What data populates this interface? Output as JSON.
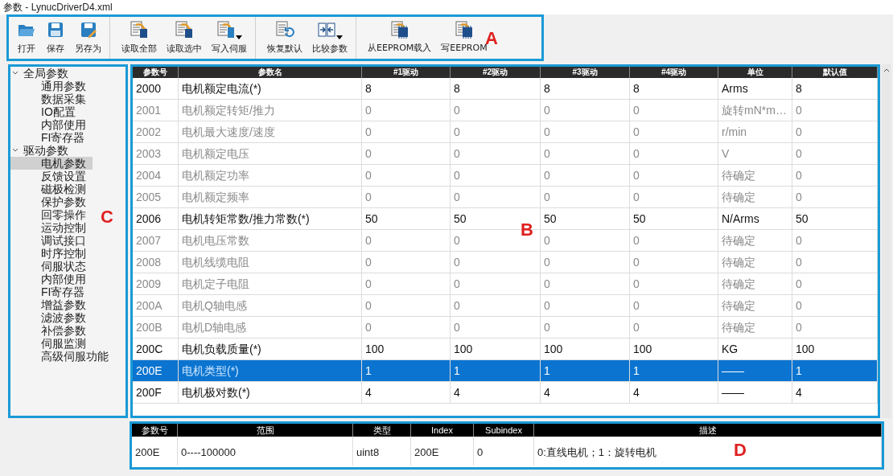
{
  "window": {
    "title": "参数 - LynucDriverD4.xml"
  },
  "toolbar": {
    "annotation": "A",
    "groups": [
      {
        "buttons": [
          {
            "label": "打开",
            "has_menu": false
          },
          {
            "label": "保存",
            "has_menu": false
          },
          {
            "label": "另存为",
            "has_menu": false
          }
        ]
      },
      {
        "buttons": [
          {
            "label": "读取全部",
            "has_menu": false
          },
          {
            "label": "读取选中",
            "has_menu": false
          },
          {
            "label": "写入伺服",
            "has_menu": true
          }
        ]
      },
      {
        "buttons": [
          {
            "label": "恢复默认",
            "has_menu": false
          },
          {
            "label": "比较参数",
            "has_menu": true
          }
        ]
      },
      {
        "buttons": [
          {
            "label": "从EEPROM载入",
            "has_menu": false
          },
          {
            "label": "写EEPROM",
            "has_menu": false
          }
        ]
      }
    ]
  },
  "tree": {
    "annotation": "C",
    "items": [
      {
        "label": "全局参数",
        "expanded": true,
        "selected": false,
        "children": [
          {
            "label": "通用参数",
            "selected": false
          },
          {
            "label": "数据采集",
            "selected": false
          },
          {
            "label": "IO配置",
            "selected": false
          },
          {
            "label": "内部使用",
            "selected": false
          },
          {
            "label": "FI寄存器",
            "selected": false
          }
        ]
      },
      {
        "label": "驱动参数",
        "expanded": true,
        "selected": false,
        "children": [
          {
            "label": "电机参数",
            "selected": true
          },
          {
            "label": "反馈设置",
            "selected": false
          },
          {
            "label": "磁极检测",
            "selected": false
          },
          {
            "label": "保护参数",
            "selected": false
          },
          {
            "label": "回零操作",
            "selected": false
          },
          {
            "label": "运动控制",
            "selected": false
          },
          {
            "label": "调试接口",
            "selected": false
          },
          {
            "label": "时序控制",
            "selected": false
          },
          {
            "label": "伺服状态",
            "selected": false
          },
          {
            "label": "内部使用",
            "selected": false
          },
          {
            "label": "FI寄存器",
            "selected": false
          },
          {
            "label": "增益参数",
            "selected": false
          },
          {
            "label": "滤波参数",
            "selected": false
          },
          {
            "label": "补偿参数",
            "selected": false
          },
          {
            "label": "伺服监测",
            "selected": false
          },
          {
            "label": "高级伺服功能",
            "selected": false
          }
        ]
      }
    ]
  },
  "table": {
    "annotation": "B",
    "columns": [
      "参数号",
      "参数名",
      "#1驱动",
      "#2驱动",
      "#3驱动",
      "#4驱动",
      "单位",
      "默认值"
    ],
    "rows": [
      {
        "cells": [
          "2000",
          "电机额定电流(*)",
          "8",
          "8",
          "8",
          "8",
          "Arms",
          "8"
        ],
        "editable": true,
        "selected": false
      },
      {
        "cells": [
          "2001",
          "电机额定转矩/推力",
          "0",
          "0",
          "0",
          "0",
          "旋转mN*m…",
          "0"
        ],
        "editable": false,
        "selected": false
      },
      {
        "cells": [
          "2002",
          "电机最大速度/速度",
          "0",
          "0",
          "0",
          "0",
          "r/min",
          "0"
        ],
        "editable": false,
        "selected": false
      },
      {
        "cells": [
          "2003",
          "电机额定电压",
          "0",
          "0",
          "0",
          "0",
          "V",
          "0"
        ],
        "editable": false,
        "selected": false
      },
      {
        "cells": [
          "2004",
          "电机额定功率",
          "0",
          "0",
          "0",
          "0",
          "待确定",
          "0"
        ],
        "editable": false,
        "selected": false
      },
      {
        "cells": [
          "2005",
          "电机额定频率",
          "0",
          "0",
          "0",
          "0",
          "待确定",
          "0"
        ],
        "editable": false,
        "selected": false
      },
      {
        "cells": [
          "2006",
          "电机转矩常数/推力常数(*)",
          "50",
          "50",
          "50",
          "50",
          "N/Arms",
          "50"
        ],
        "editable": true,
        "selected": false
      },
      {
        "cells": [
          "2007",
          "电机电压常数",
          "0",
          "0",
          "0",
          "0",
          "待确定",
          "0"
        ],
        "editable": false,
        "selected": false
      },
      {
        "cells": [
          "2008",
          "电机线缆电阻",
          "0",
          "0",
          "0",
          "0",
          "待确定",
          "0"
        ],
        "editable": false,
        "selected": false
      },
      {
        "cells": [
          "2009",
          "电机定子电阻",
          "0",
          "0",
          "0",
          "0",
          "待确定",
          "0"
        ],
        "editable": false,
        "selected": false
      },
      {
        "cells": [
          "200A",
          "电机Q轴电感",
          "0",
          "0",
          "0",
          "0",
          "待确定",
          "0"
        ],
        "editable": false,
        "selected": false
      },
      {
        "cells": [
          "200B",
          "电机D轴电感",
          "0",
          "0",
          "0",
          "0",
          "待确定",
          "0"
        ],
        "editable": false,
        "selected": false
      },
      {
        "cells": [
          "200C",
          "电机负载质量(*)",
          "100",
          "100",
          "100",
          "100",
          "KG",
          "100"
        ],
        "editable": true,
        "selected": false
      },
      {
        "cells": [
          "200E",
          "电机类型(*)",
          "1",
          "1",
          "1",
          "1",
          "——",
          "1"
        ],
        "editable": true,
        "selected": true
      },
      {
        "cells": [
          "200F",
          "电机极对数(*)",
          "4",
          "4",
          "4",
          "4",
          "——",
          "4"
        ],
        "editable": true,
        "selected": false
      }
    ]
  },
  "detail": {
    "annotation": "D",
    "columns": [
      "参数号",
      "范围",
      "类型",
      "Index",
      "Subindex",
      "描述"
    ],
    "values": [
      "200E",
      "0----100000",
      "uint8",
      "200E",
      "0",
      "0:直线电机；1：旋转电机"
    ]
  }
}
